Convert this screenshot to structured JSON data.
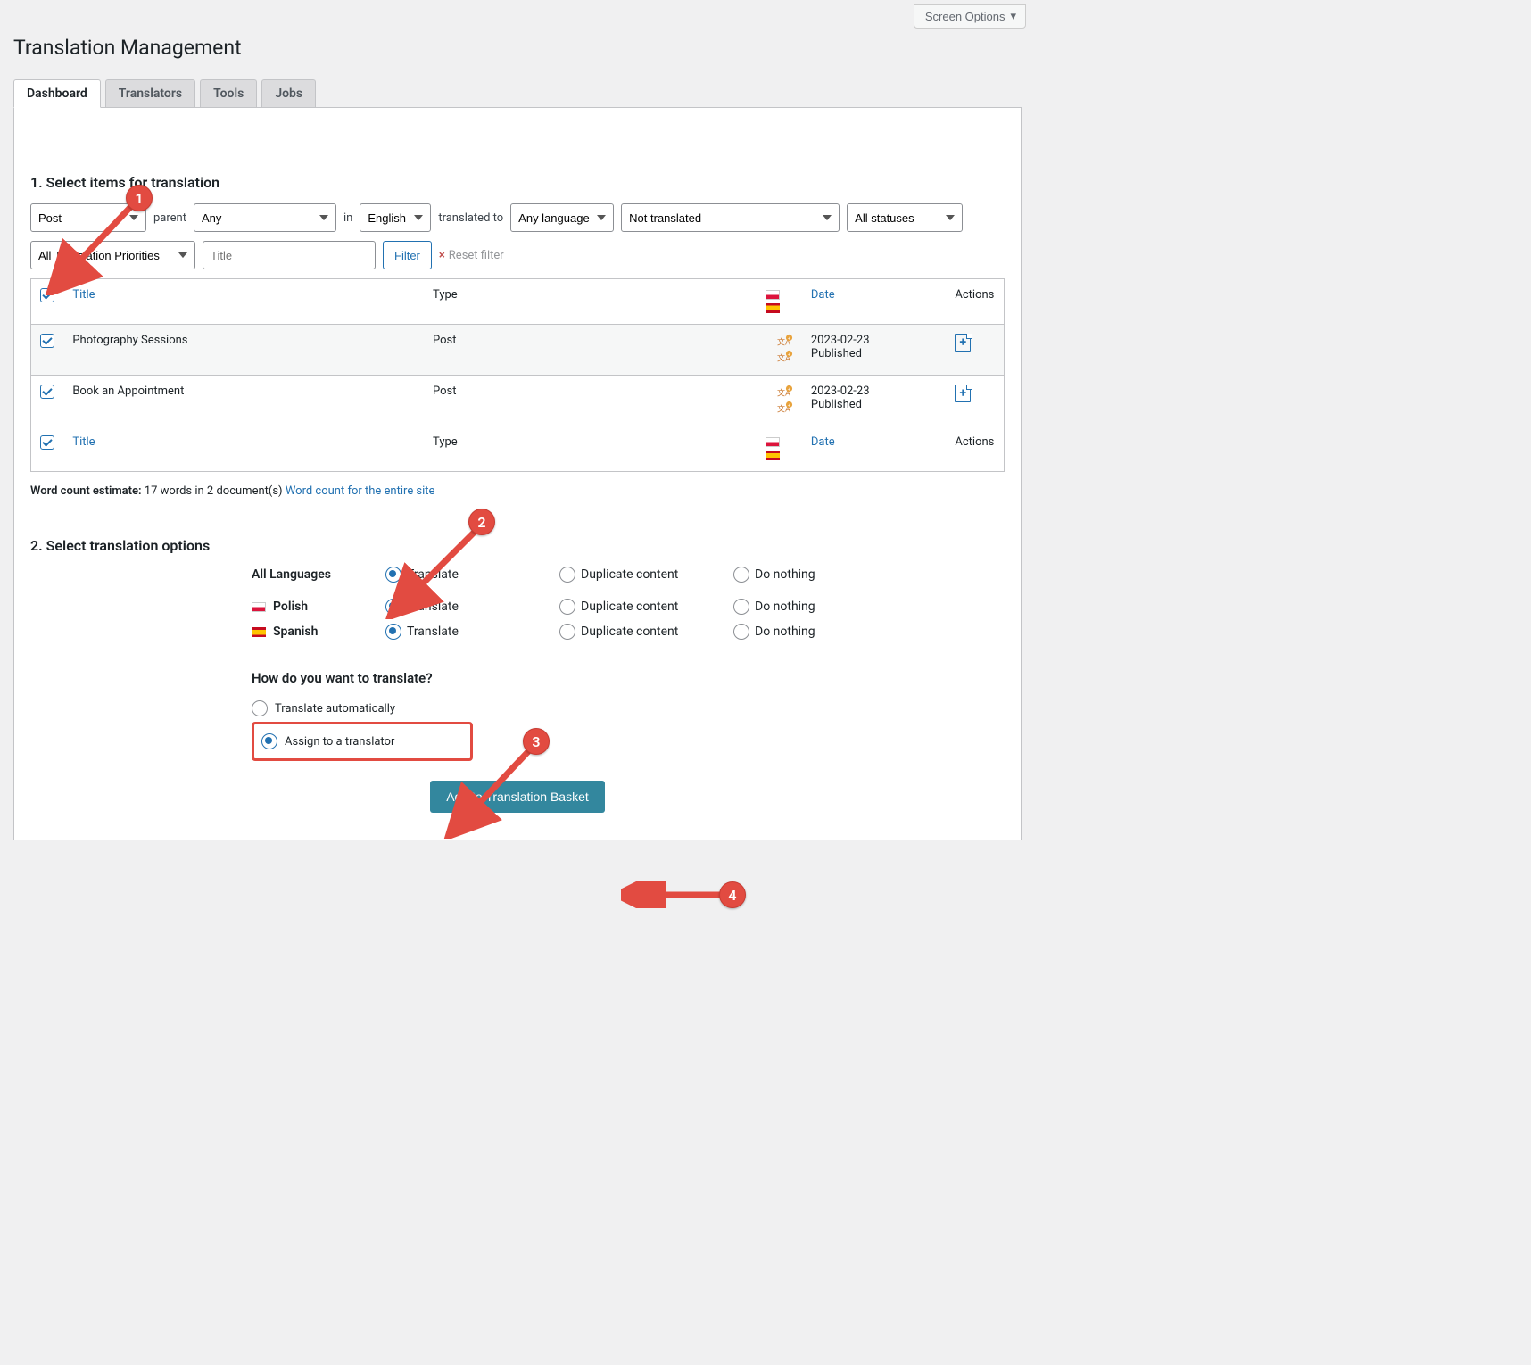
{
  "screen_options": "Screen Options",
  "page_title": "Translation Management",
  "tabs": [
    "Dashboard",
    "Translators",
    "Tools",
    "Jobs"
  ],
  "active_tab": 0,
  "section1_heading": "1. Select items for translation",
  "filters": {
    "post_type": "Post",
    "parent_label": "parent",
    "parent": "Any",
    "in_label": "in",
    "lang": "English",
    "translated_to_label": "translated to",
    "target_lang": "Any language",
    "status": "Not translated",
    "status2": "All statuses",
    "priority": "All Translation Priorities",
    "title_placeholder": "Title",
    "filter_btn": "Filter",
    "reset": "Reset filter"
  },
  "table": {
    "headers": {
      "title": "Title",
      "type": "Type",
      "date": "Date",
      "actions": "Actions"
    },
    "rows": [
      {
        "title": "Photography Sessions",
        "type": "Post",
        "date1": "2023-02-23",
        "date2": "Published"
      },
      {
        "title": "Book an Appointment",
        "type": "Post",
        "date1": "2023-02-23",
        "date2": "Published"
      }
    ]
  },
  "word_count_label": "Word count estimate:",
  "word_count_text": "17 words in 2 document(s)",
  "word_count_link": "Word count for the entire site",
  "section2_heading": "2. Select translation options",
  "options": {
    "all_lang_label": "All Languages",
    "polish_label": "Polish",
    "spanish_label": "Spanish",
    "translate": "Translate",
    "duplicate": "Duplicate content",
    "nothing": "Do nothing"
  },
  "how_translate": {
    "heading": "How do you want to translate?",
    "auto": "Translate automatically",
    "assign": "Assign to a translator"
  },
  "basket_btn": "Add to Translation Basket",
  "annotations": {
    "1": "1",
    "2": "2",
    "3": "3",
    "4": "4"
  }
}
